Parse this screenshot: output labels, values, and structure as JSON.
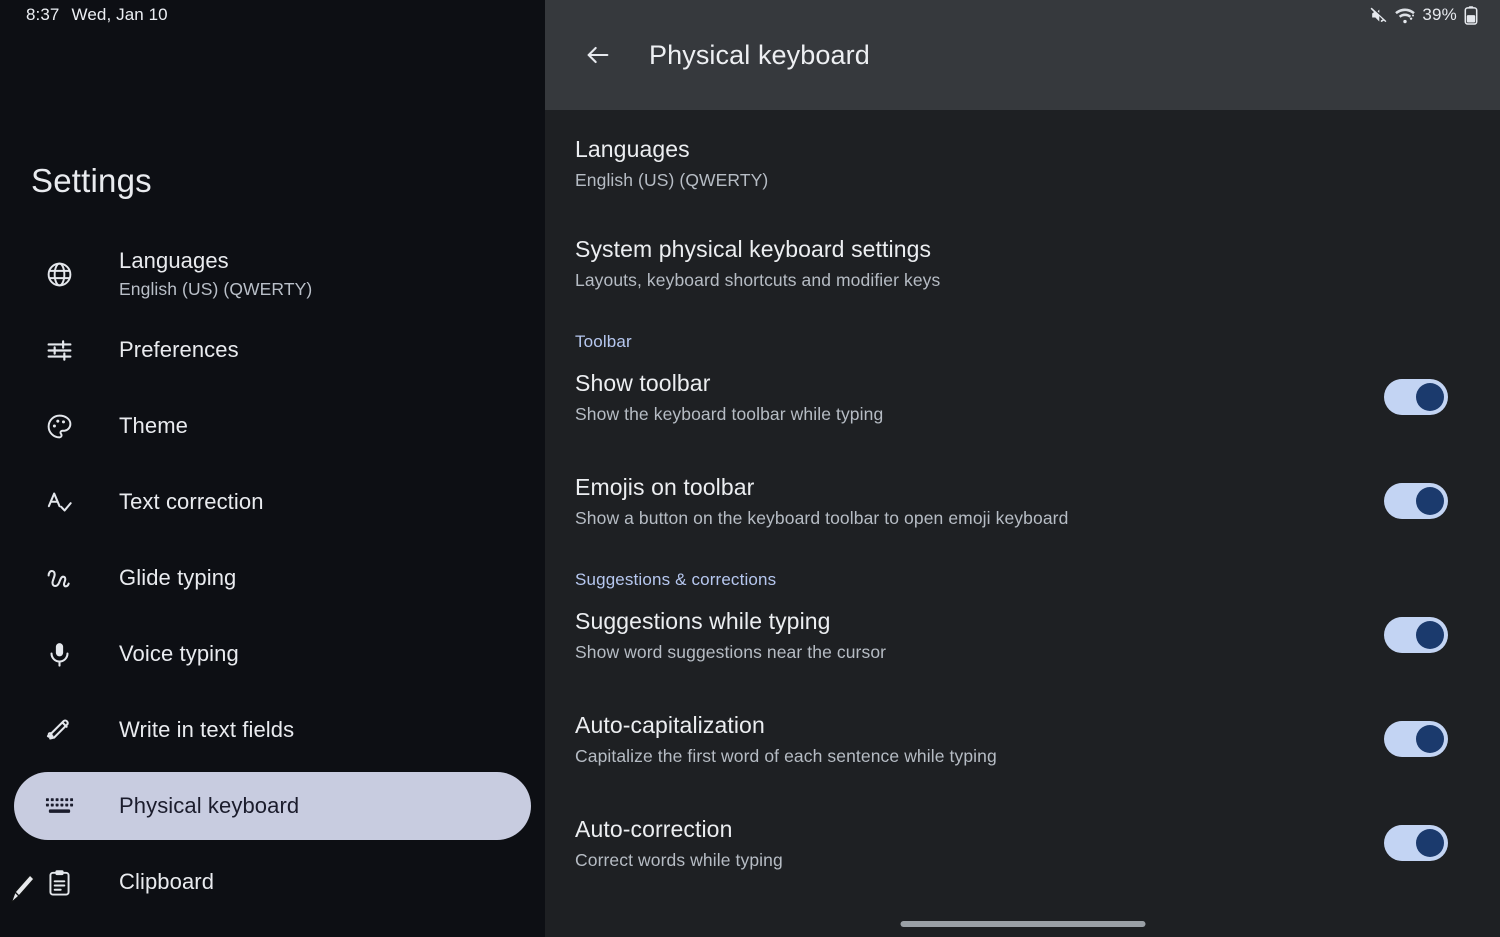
{
  "status_bar": {
    "time": "8:37",
    "date": "Wed, Jan 10",
    "battery_percent": "39%",
    "icons": [
      "volume-off-icon",
      "wifi-icon",
      "battery-icon"
    ]
  },
  "sidebar": {
    "title": "Settings",
    "items": [
      {
        "label": "Languages",
        "sub": "English (US) (QWERTY)",
        "icon": "globe-icon",
        "selected": false
      },
      {
        "label": "Preferences",
        "sub": "",
        "icon": "tune-icon",
        "selected": false
      },
      {
        "label": "Theme",
        "sub": "",
        "icon": "palette-icon",
        "selected": false
      },
      {
        "label": "Text correction",
        "sub": "",
        "icon": "spellcheck-icon",
        "selected": false
      },
      {
        "label": "Glide typing",
        "sub": "",
        "icon": "gesture-icon",
        "selected": false
      },
      {
        "label": "Voice typing",
        "sub": "",
        "icon": "microphone-icon",
        "selected": false
      },
      {
        "label": "Write in text fields",
        "sub": "",
        "icon": "handwriting-pen-icon",
        "selected": false
      },
      {
        "label": "Physical keyboard",
        "sub": "",
        "icon": "keyboard-icon",
        "selected": true
      },
      {
        "label": "Clipboard",
        "sub": "",
        "icon": "clipboard-icon",
        "selected": false
      }
    ]
  },
  "panel": {
    "title": "Physical keyboard",
    "back_icon": "arrow-left-icon",
    "rows": [
      {
        "title": "Languages",
        "sub": "English (US) (QWERTY)",
        "toggle": null
      },
      {
        "title": "System physical keyboard settings",
        "sub": "Layouts, keyboard shortcuts and modifier keys",
        "toggle": null
      }
    ],
    "sections": [
      {
        "header": "Toolbar",
        "rows": [
          {
            "title": "Show toolbar",
            "sub": "Show the keyboard toolbar while typing",
            "toggle": "on"
          },
          {
            "title": "Emojis on toolbar",
            "sub": "Show a button on the keyboard toolbar to open emoji keyboard",
            "toggle": "on"
          }
        ]
      },
      {
        "header": "Suggestions & corrections",
        "rows": [
          {
            "title": "Suggestions while typing",
            "sub": "Show word suggestions near the cursor",
            "toggle": "on"
          },
          {
            "title": "Auto-capitalization",
            "sub": "Capitalize the first word of each sentence while typing",
            "toggle": "on"
          },
          {
            "title": "Auto-correction",
            "sub": "Correct words while typing",
            "toggle": "on"
          }
        ]
      }
    ]
  },
  "colors": {
    "sidebar_bg": "#0d0f14",
    "panel_bg": "#1e2023",
    "header_bg": "#36393d",
    "selected_pill": "#c8cce0",
    "selected_text": "#1b1c2c",
    "section_header": "#b6c7ef",
    "toggle_track_on": "#c3d4f3",
    "toggle_knob_on": "#1b3a6d"
  }
}
